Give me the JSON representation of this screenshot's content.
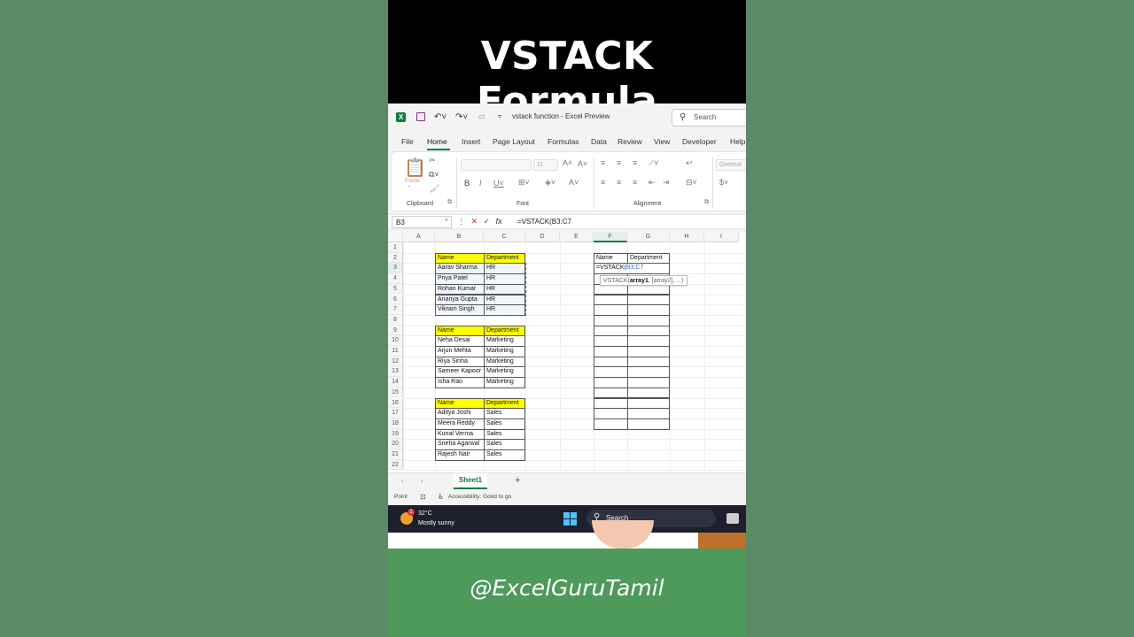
{
  "banner": {
    "title": "VSTACK Formula"
  },
  "window": {
    "title": "vstack function  -  Excel Preview",
    "search_placeholder": "Search"
  },
  "menu": [
    "File",
    "Home",
    "Insert",
    "Page Layout",
    "Formulas",
    "Data",
    "Review",
    "View",
    "Developer",
    "Help"
  ],
  "ribbon": {
    "groups": [
      "Clipboard",
      "Font",
      "Alignment"
    ],
    "paste_label": "Paste",
    "font_size": "11",
    "number_format": "General"
  },
  "formula_bar": {
    "name_box": "B3",
    "formula": "=VSTACK(B3:C7"
  },
  "grid": {
    "columns": [
      "A",
      "B",
      "C",
      "D",
      "E",
      "F",
      "G",
      "H",
      "I"
    ],
    "rows": [
      "1",
      "2",
      "3",
      "4",
      "5",
      "6",
      "7",
      "8",
      "9",
      "10",
      "11",
      "12",
      "13",
      "14",
      "15",
      "16",
      "17",
      "18",
      "19",
      "20",
      "21",
      "22"
    ],
    "tables": [
      {
        "header": [
          "Name",
          "Department"
        ],
        "rows": [
          [
            "Aarav Sharma",
            "HR"
          ],
          [
            "Priya Patel",
            "HR"
          ],
          [
            "Rohan Kumar",
            "HR"
          ],
          [
            "Ananya Gupta",
            "HR"
          ],
          [
            "Vikram Singh",
            "HR"
          ]
        ]
      },
      {
        "header": [
          "Name",
          "Department"
        ],
        "rows": [
          [
            "Neha Desai",
            "Marketing"
          ],
          [
            "Arjun Mehta",
            "Marketing"
          ],
          [
            "Riya Sinha",
            "Marketing"
          ],
          [
            "Sameer Kapoor",
            "Marketing"
          ],
          [
            "Isha Rao",
            "Marketing"
          ]
        ]
      },
      {
        "header": [
          "Name",
          "Department"
        ],
        "rows": [
          [
            "Aditya Joshi",
            "Sales"
          ],
          [
            "Meera Reddy",
            "Sales"
          ],
          [
            "Kunal Verma",
            "Sales"
          ],
          [
            "Sneha Agarwal",
            "Sales"
          ],
          [
            "Rajesh Nair",
            "Sales"
          ]
        ]
      }
    ],
    "output": {
      "header": [
        "Name",
        "Department"
      ],
      "editing_prefix": "=VSTACK(",
      "editing_ref": "B3:C7"
    },
    "tooltip": {
      "fn": "VSTACK(",
      "arg1": "array1",
      "rest": ", [array2], ...)"
    }
  },
  "sheets": {
    "active": "Sheet1",
    "add": "+"
  },
  "status": {
    "mode": "Point",
    "accessibility": "Accessibility: Good to go"
  },
  "taskbar": {
    "temp": "32°C",
    "condition": "Mostly sunny",
    "search": "Search",
    "badge": "1"
  },
  "footer": {
    "handle": "@ExcelGuruTamil"
  },
  "colors": {
    "excel_green": "#107c41",
    "header_yellow": "#ffff00",
    "footer_green": "#4e9a5b"
  }
}
